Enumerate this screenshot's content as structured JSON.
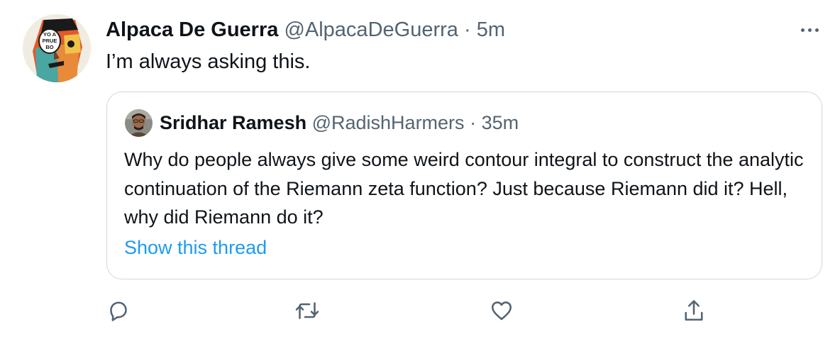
{
  "tweet": {
    "author_name": "Alpaca De Guerra",
    "handle": "@AlpacaDeGuerra",
    "separator": "·",
    "time": "5m",
    "text": "I’m always asking this.",
    "avatar_text": [
      "YO A",
      "PRUE",
      "BO"
    ]
  },
  "quoted_tweet": {
    "author_name": "Sridhar Ramesh",
    "handle": "@RadishHarmers",
    "separator": "·",
    "time": "35m",
    "text": "Why do people always give some weird contour integral to construct the analytic continuation of the Riemann zeta function? Just because Riemann did it? Hell, why did Riemann do it?",
    "thread_link": "Show this thread"
  },
  "actions": [
    {
      "icon": "reply-icon"
    },
    {
      "icon": "retweet-icon"
    },
    {
      "icon": "like-icon"
    },
    {
      "icon": "share-icon"
    }
  ],
  "colors": {
    "text": "#0f1419",
    "muted": "#536471",
    "link": "#1d9bf0",
    "border": "#cfd9de"
  }
}
